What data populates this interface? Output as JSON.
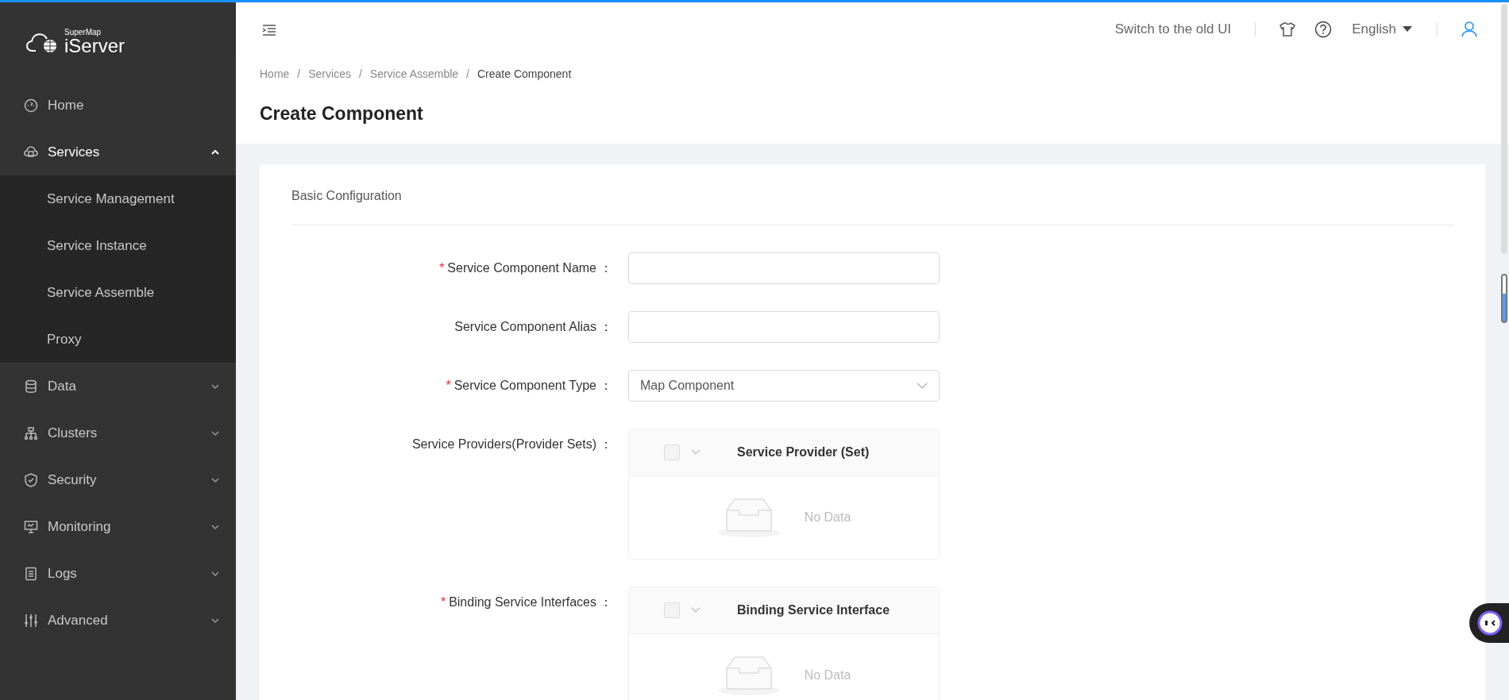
{
  "sidebar": {
    "logo": {
      "brand": "SuperMap",
      "product": "iServer"
    },
    "items": [
      {
        "label": "Home"
      },
      {
        "label": "Services",
        "expanded": true,
        "children": [
          {
            "label": "Service Management"
          },
          {
            "label": "Service Instance"
          },
          {
            "label": "Service Assemble"
          },
          {
            "label": "Proxy"
          }
        ]
      },
      {
        "label": "Data",
        "expanded": false
      },
      {
        "label": "Clusters",
        "expanded": false
      },
      {
        "label": "Security",
        "expanded": false
      },
      {
        "label": "Monitoring",
        "expanded": false
      },
      {
        "label": "Logs",
        "expanded": false
      },
      {
        "label": "Advanced",
        "expanded": false
      }
    ]
  },
  "header": {
    "switch_link": "Switch to the old UI",
    "language": "English"
  },
  "breadcrumb": [
    {
      "label": "Home",
      "current": false
    },
    {
      "separator": "/",
      "label": "Services",
      "current": false
    },
    {
      "separator": "/",
      "label": "Service Assemble",
      "current": false
    },
    {
      "separator": "/",
      "label": "Create Component",
      "current": true
    }
  ],
  "page_title": "Create Component",
  "section_title": "Basic Configuration",
  "form": [
    {
      "kind": "text",
      "required_mark": "*",
      "label": "Service Component Name",
      "colon": "："
    },
    {
      "kind": "text",
      "label": "Service Component Alias",
      "colon": "："
    },
    {
      "kind": "select",
      "required_mark": "*",
      "label": "Service Component Type",
      "colon": "：",
      "value": "Map Component"
    },
    {
      "kind": "transfer",
      "label": "Service Providers(Provider Sets)",
      "colon": "：",
      "header": "Service Provider (Set)",
      "checked": false,
      "empty_text": "No Data"
    },
    {
      "kind": "transfer",
      "required_mark": "*",
      "label": "Binding Service Interfaces",
      "colon": "：",
      "header": "Binding Service Interface",
      "checked": false,
      "empty_text": "No Data"
    }
  ]
}
